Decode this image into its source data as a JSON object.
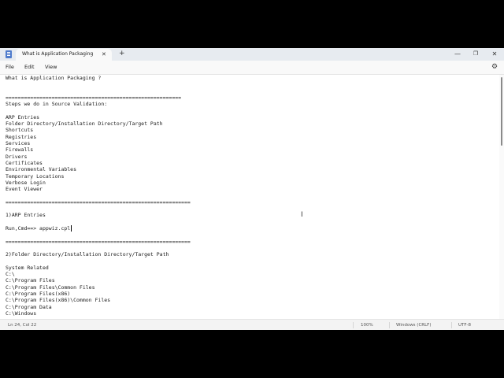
{
  "tab": {
    "title": "What is Application Packaging"
  },
  "icons": {
    "app": "notepad-icon",
    "tab_close": "close-icon",
    "new_tab": "plus-icon",
    "minimize": "minimize-icon",
    "maximize": "maximize-icon",
    "close": "close-icon",
    "settings": "gear-icon"
  },
  "menu": {
    "file": "File",
    "edit": "Edit",
    "view": "View"
  },
  "editor": {
    "lines": [
      "What is Application Packaging ?",
      "",
      "",
      "=========================================================",
      "Steps we do in Source Validation:",
      "",
      "ARP Entries",
      "Folder Directory/Installation Directory/Target Path",
      "Shortcuts",
      "Registries",
      "Services",
      "Firewalls",
      "Drivers",
      "Certificates",
      "Environmental Variables",
      "Temporary Locations",
      "Verbose Login",
      "Event Viewer",
      "",
      "============================================================",
      "",
      "1)ARP Entries",
      "",
      "Run,Cmd==> appwiz.cpl",
      "",
      "============================================================",
      "",
      "2)Folder Directory/Installation Directory/Target Path",
      "",
      "System Related",
      "C:\\",
      "C:\\Program Files",
      "C:\\Program Files\\Common Files",
      "C:\\Program Files(x86)",
      "C:\\Program Files(x86)\\Common Files",
      "C:\\Program Data",
      "C:\\Windows"
    ]
  },
  "status": {
    "position": "Ln 24, Col 22",
    "zoom": "100%",
    "line_ending": "Windows (CRLF)",
    "encoding": "UTF-8"
  }
}
